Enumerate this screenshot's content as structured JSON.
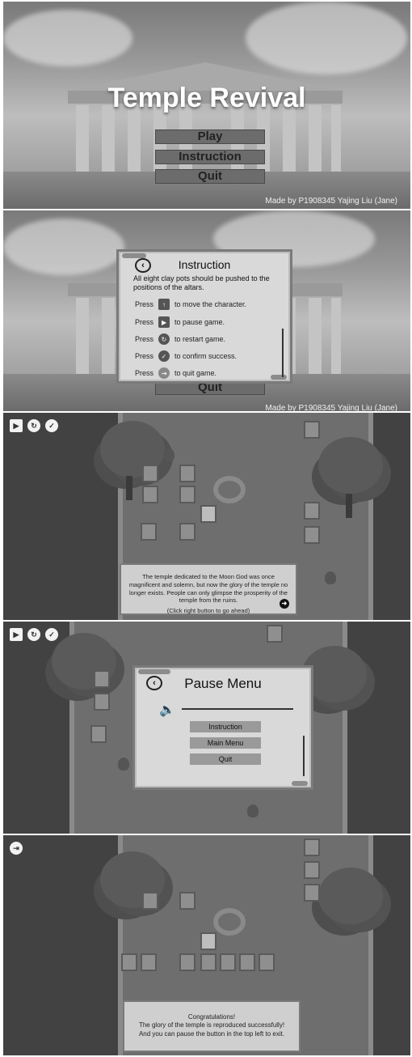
{
  "title_screen": {
    "title": "Temple Revival",
    "menu": [
      "Play",
      "Instruction",
      "Quit"
    ],
    "credit": "Made by P1908345 Yajing Liu (Jane)"
  },
  "instruction_screen": {
    "heading": "Instruction",
    "intro": "All eight clay pots should be pushed to the positions of the altars.",
    "rows": [
      {
        "prefix": "Press",
        "icon": "arrow-keys-icon",
        "text": "to move the character."
      },
      {
        "prefix": "Press",
        "icon": "play-pause-icon",
        "text": "to pause game."
      },
      {
        "prefix": "Press",
        "icon": "restart-icon",
        "text": "to restart game."
      },
      {
        "prefix": "Press",
        "icon": "check-icon",
        "text": "to confirm success."
      },
      {
        "prefix": "Press",
        "icon": "exit-icon",
        "text": "to quit game."
      }
    ],
    "bg_quit": "Quit",
    "bg_credit": "Made by P1908345 Yajing Liu (Jane)"
  },
  "game_screen": {
    "story_text": "The temple dedicated to the Moon God was once magnificent and solemn, but now the glory of the temple no longer exists. People can only glimpse the prosperity of the temple from the ruins.",
    "continue_hint": "(Click right button to go ahead)"
  },
  "pause_screen": {
    "heading": "Pause Menu",
    "buttons": [
      "Instruction",
      "Main Menu",
      "Quit"
    ],
    "volume_icon": "speaker-icon"
  },
  "win_screen": {
    "line1": "Congratulations!",
    "line2": "The glory of the temple is reproduced successfully!",
    "line3": "And you can pause the button in the top left to exit."
  },
  "colors": {
    "floor": "#6e6e6e",
    "wall": "#424242",
    "parchment": "#d9d9d9"
  }
}
